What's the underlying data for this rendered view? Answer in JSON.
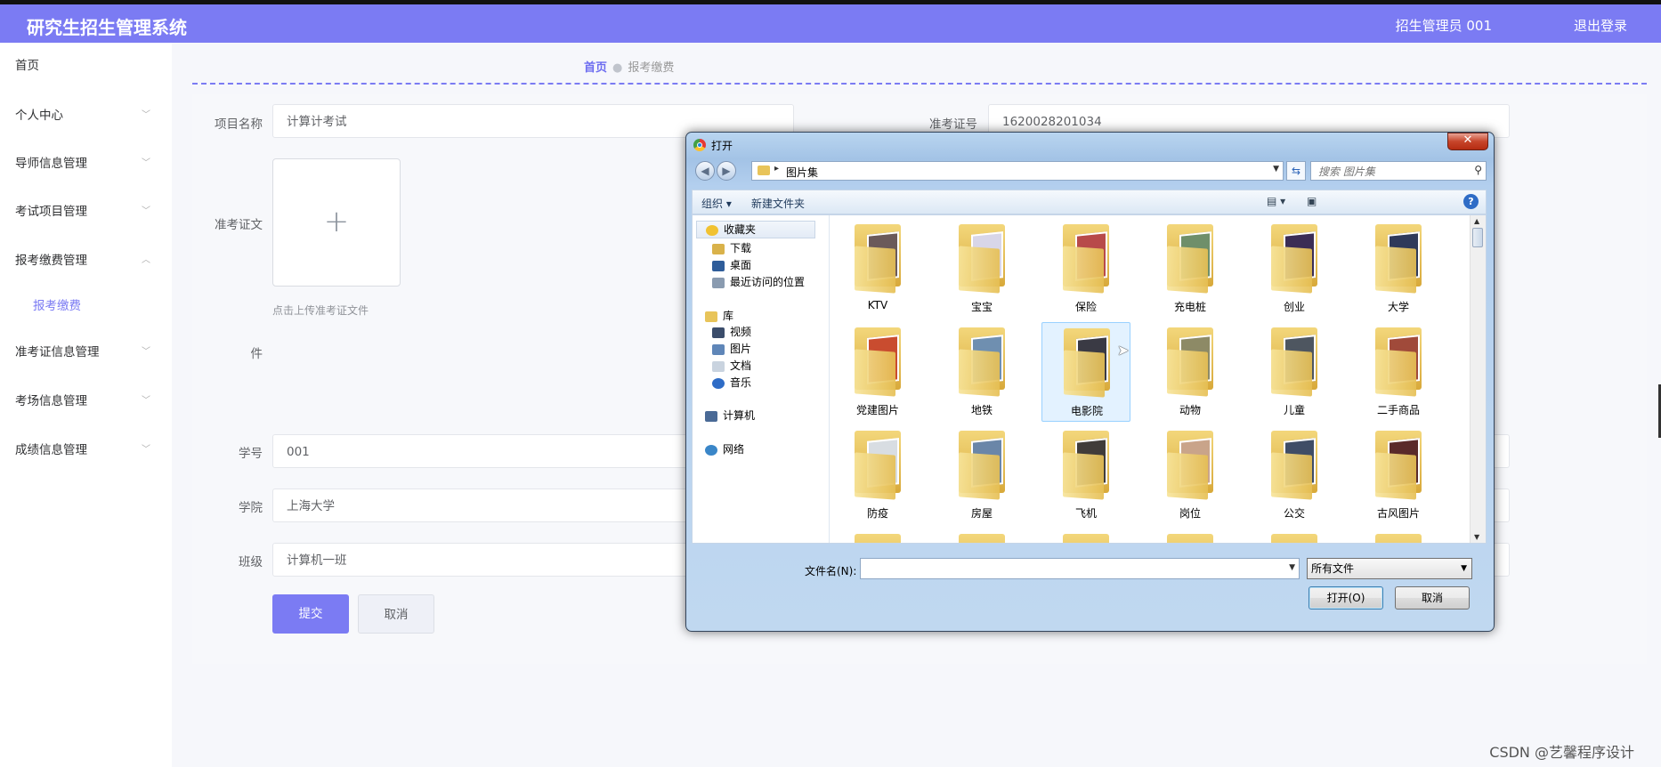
{
  "header": {
    "title": "研究生招生管理系统",
    "user": "招生管理员 001",
    "logout": "退出登录"
  },
  "sidebar": {
    "items": [
      {
        "label": "首页"
      },
      {
        "label": "个人中心"
      },
      {
        "label": "导师信息管理"
      },
      {
        "label": "考试项目管理"
      },
      {
        "label": "报考缴费管理"
      },
      {
        "label": "报考缴费"
      },
      {
        "label": "准考证信息管理"
      },
      {
        "label": "考场信息管理"
      },
      {
        "label": "成绩信息管理"
      }
    ]
  },
  "breadcrumb": {
    "home": "首页",
    "current": "报考缴费"
  },
  "form": {
    "project_label": "项目名称",
    "project_value": "计算计考试",
    "ticket_no_label": "准考证号",
    "ticket_no_value": "1620028201034",
    "ticket_file_label": "准考证文",
    "ticket_file_label_2": "件",
    "upload_hint": "点击上传准考证文件",
    "student_id_label": "学号",
    "student_id_value": "001",
    "college_label": "学院",
    "college_value": "上海大学",
    "class_label": "班级",
    "class_value": "计算机一班",
    "submit": "提交",
    "cancel": "取消"
  },
  "dialog": {
    "title": "打开",
    "path": "图片集",
    "search_placeholder": "搜索 图片集",
    "toolbar": {
      "organize": "组织 ▾",
      "new_folder": "新建文件夹"
    },
    "nav": {
      "favorites": "收藏夹",
      "downloads": "下载",
      "desktop": "桌面",
      "recent": "最近访问的位置",
      "libraries": "库",
      "videos": "视频",
      "pictures": "图片",
      "documents": "文档",
      "music": "音乐",
      "computer": "计算机",
      "network": "网络"
    },
    "folders": [
      {
        "name": "KTV",
        "photo": "#6b5a5a"
      },
      {
        "name": "宝宝",
        "photo": "#d8d6e8"
      },
      {
        "name": "保险",
        "photo": "#b84a4a"
      },
      {
        "name": "充电桩",
        "photo": "#6f8f6a"
      },
      {
        "name": "创业",
        "photo": "#3b2d55"
      },
      {
        "name": "大学",
        "photo": "#2f3a5a"
      },
      {
        "name": "党建图片",
        "photo": "#c94c2f"
      },
      {
        "name": "地铁",
        "photo": "#6f8fb0"
      },
      {
        "name": "电影院",
        "photo": "#3a3a44"
      },
      {
        "name": "动物",
        "photo": "#8d8a66"
      },
      {
        "name": "儿童",
        "photo": "#4e5660"
      },
      {
        "name": "二手商品",
        "photo": "#a04a3a"
      },
      {
        "name": "防疫",
        "photo": "#d8dde2"
      },
      {
        "name": "房屋",
        "photo": "#6a86a8"
      },
      {
        "name": "飞机",
        "photo": "#403c3a"
      },
      {
        "name": "岗位",
        "photo": "#c9a48a"
      },
      {
        "name": "公交",
        "photo": "#3f4d66"
      },
      {
        "name": "古风图片",
        "photo": "#5a2a2a"
      }
    ],
    "filename_label": "文件名(N):",
    "filename_value": "",
    "filetype": "所有文件",
    "open": "打开(O)",
    "cancel": "取消"
  },
  "watermark": "CSDN @艺馨程序设计"
}
